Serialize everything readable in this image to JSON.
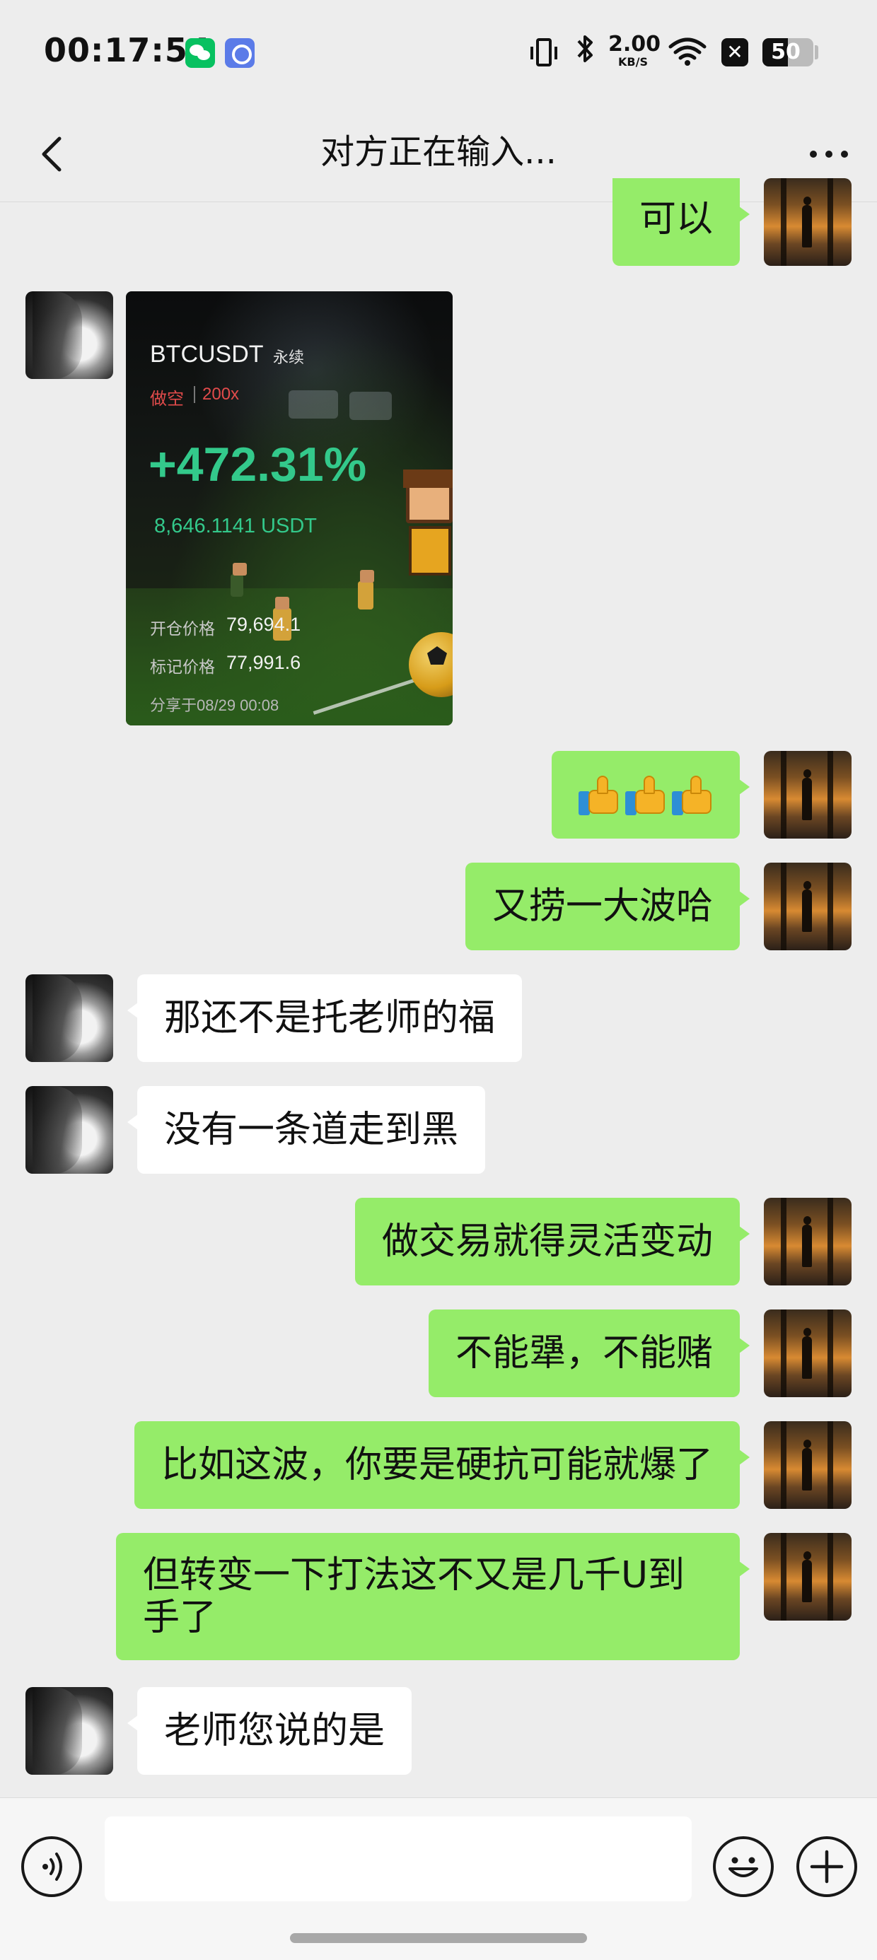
{
  "status_bar": {
    "time": "00:17:54",
    "icons": [
      "wechat-icon",
      "browser-icon",
      "vibrate-icon",
      "bluetooth-icon",
      "wifi-icon",
      "close-app-icon",
      "battery-icon"
    ],
    "net_speed_value": "2.00",
    "net_speed_unit": "KB/S",
    "battery_level": "50"
  },
  "header": {
    "title": "对方正在输入..."
  },
  "messages": [
    {
      "side": "self",
      "type": "text",
      "text": "可以"
    },
    {
      "side": "other",
      "type": "trade-card"
    },
    {
      "side": "self",
      "type": "emoji",
      "emoji": "thumbs-up x3"
    },
    {
      "side": "self",
      "type": "text",
      "text": "又捞一大波哈"
    },
    {
      "side": "other",
      "type": "text",
      "text": "那还不是托老师的福"
    },
    {
      "side": "other",
      "type": "text",
      "text": "没有一条道走到黑"
    },
    {
      "side": "self",
      "type": "text",
      "text": "做交易就得灵活变动"
    },
    {
      "side": "self",
      "type": "text",
      "text": "不能犟，不能赌"
    },
    {
      "side": "self",
      "type": "text",
      "text": "比如这波，你要是硬抗可能就爆了"
    },
    {
      "side": "self",
      "type": "text",
      "text": "但转变一下打法这不又是几千U到手了"
    },
    {
      "side": "other",
      "type": "text",
      "text": "老师您说的是"
    }
  ],
  "trade_card": {
    "symbol": "BTCUSDT",
    "contract_type": "永续",
    "direction": "做空",
    "leverage": "200x",
    "roi": "+472.31%",
    "pnl": "8,646.1141 USDT",
    "entry_label": "开仓价格",
    "entry_price": "79,694.1",
    "mark_label": "标记价格",
    "mark_price": "77,991.6",
    "shared_at": "分享于08/29 00:08",
    "colors": {
      "profit": "#33c98b",
      "short": "#e24b4b"
    }
  },
  "input_bar": {
    "value": "",
    "icons": [
      "voice-icon",
      "emoji-icon",
      "plus-icon"
    ]
  },
  "colors": {
    "self_bubble": "#95ec69",
    "other_bubble": "#ffffff",
    "background": "#ededed"
  }
}
